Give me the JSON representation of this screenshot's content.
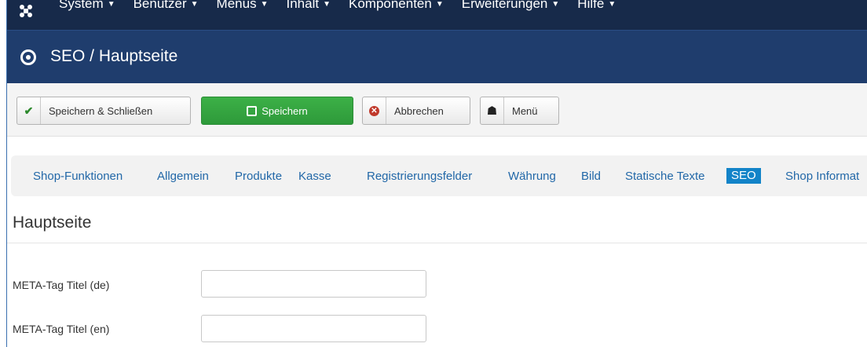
{
  "topnav": {
    "items": [
      "System",
      "Benutzer",
      "Menüs",
      "Inhalt",
      "Komponenten",
      "Erweiterungen",
      "Hilfe"
    ],
    "caret": "▼"
  },
  "header": {
    "icon": "target-icon",
    "title": "SEO / Hauptseite"
  },
  "toolbar": {
    "save_close_label": "Speichern & Schließen",
    "save_label": "Speichern",
    "cancel_label": "Abbrechen",
    "menu_label": "Menü",
    "check_glyph": "✔",
    "cancel_glyph": "✕",
    "home_glyph": "☗"
  },
  "tabs": {
    "items": [
      "Shop-Funktionen",
      "Allgemein",
      "Produkte",
      "Kasse",
      "Registrierungsfelder",
      "Währung",
      "Bild",
      "Statische Texte",
      "SEO",
      "Shop Informat"
    ],
    "active": "SEO"
  },
  "section": {
    "title": "Hauptseite"
  },
  "form": {
    "fields": [
      {
        "label": "META-Tag Titel (de)",
        "value": "",
        "placeholder": ""
      },
      {
        "label": "META-Tag Titel (en)",
        "value": "",
        "placeholder": ""
      }
    ]
  },
  "colors": {
    "nav_bg": "#172a4a",
    "title_bg": "#1f3d6d",
    "success": "#34a53f",
    "link": "#2268a8",
    "active_tab": "#1283c8"
  }
}
